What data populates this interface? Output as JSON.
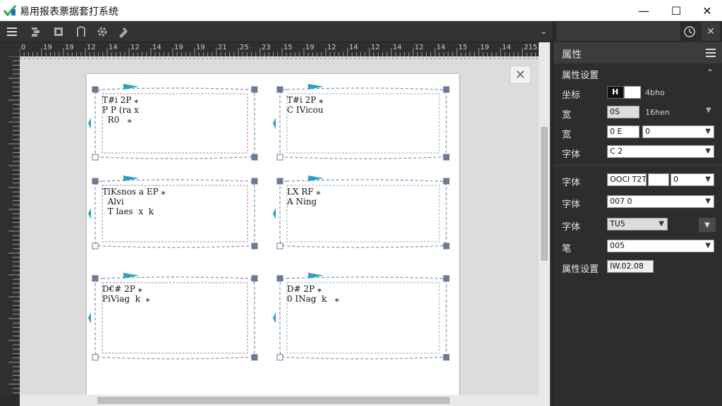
{
  "app": {
    "title": "易用报表票据套打系统",
    "window_controls": {
      "minimize": "—",
      "maximize": "☐",
      "close": "✕"
    }
  },
  "toolbar": {
    "icons": [
      "menu-icon",
      "layers-icon",
      "template-icon",
      "bracket-icon",
      "gear-icon",
      "tool-icon"
    ],
    "dropdown": "⌄"
  },
  "ruler": {
    "top_labels": [
      "0",
      "19",
      "19",
      "12",
      "14",
      "12",
      "14",
      "19",
      "19",
      "21",
      "25",
      "23",
      "15",
      "19",
      "12",
      "14",
      "12",
      "14",
      "12",
      "14",
      "15",
      "19",
      "14",
      "215",
      "15"
    ]
  },
  "labels": [
    {
      "lines": [
        "T#i 2P ⁎",
        "P P (ra x",
        "  R0   ⁎"
      ]
    },
    {
      "lines": [
        "T#i 2P ⁎",
        "C IVicou"
      ]
    },
    {
      "lines": [
        "TlKsnos a EP ⁎",
        "  Alvi",
        "  T laes  x  k"
      ]
    },
    {
      "lines": [
        "LX RF ⁎",
        "A Ning"
      ]
    },
    {
      "lines": [
        "D€# 2P ⁎",
        "PiViag  k  ⁎"
      ]
    },
    {
      "lines": [
        "D# 2P ⁎",
        "0 INag  k   ⁎"
      ]
    }
  ],
  "panel": {
    "title": "属性",
    "section": "属性设置",
    "rows": [
      {
        "label": "坐标",
        "dark": "H",
        "value": "",
        "extra": "4bho"
      },
      {
        "label": "宽",
        "value": "0S",
        "extra": "16hen"
      },
      {
        "label": "宽",
        "value": "0 E",
        "select": "0"
      },
      {
        "label": "字体",
        "select": "C 2"
      },
      {
        "label": "字体",
        "value": "OOCl T2T",
        "select": "0"
      },
      {
        "label": "字体",
        "select": "007 0"
      },
      {
        "label": "字体",
        "select": "TU5"
      },
      {
        "label": "笔",
        "select": "005"
      },
      {
        "label": "属性设置",
        "value": "IW.02.08"
      }
    ]
  }
}
